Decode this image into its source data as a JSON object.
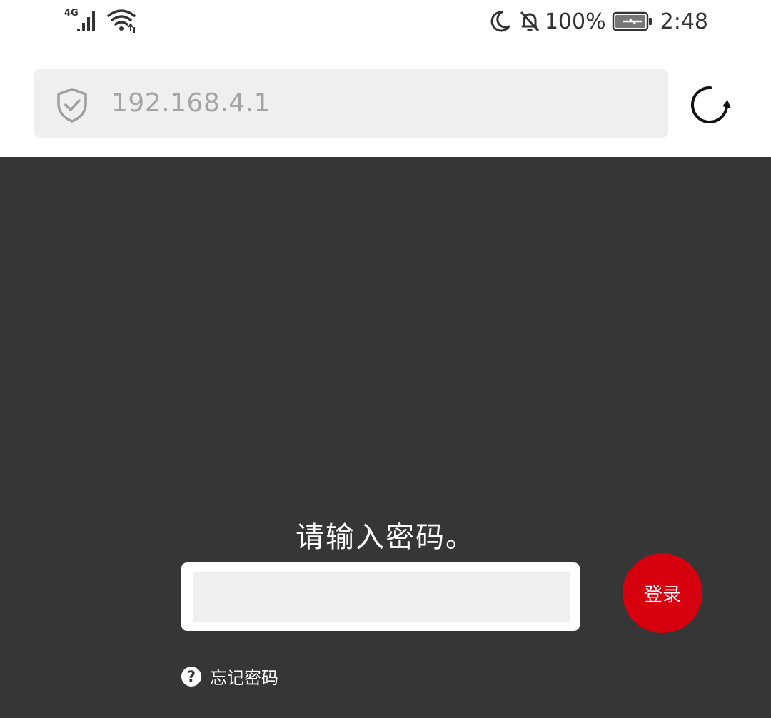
{
  "status_bar": {
    "network_type": "4G",
    "battery_level": "100%",
    "time": "2:48",
    "icons": [
      "signal-icon",
      "wifi-icon",
      "moon-icon",
      "bell-off-icon",
      "battery-charging-icon"
    ]
  },
  "browser": {
    "url": "192.168.4.1",
    "security_icon": "shield-check-icon",
    "reload_icon": "reload-icon"
  },
  "login": {
    "prompt": "请输入密码。",
    "password_value": "",
    "login_label": "登录",
    "forgot_label": "忘记密码",
    "help_icon_glyph": "?"
  },
  "colors": {
    "content_background": "#363636",
    "login_button": "#d6000e",
    "url_bar": "#efefef"
  }
}
